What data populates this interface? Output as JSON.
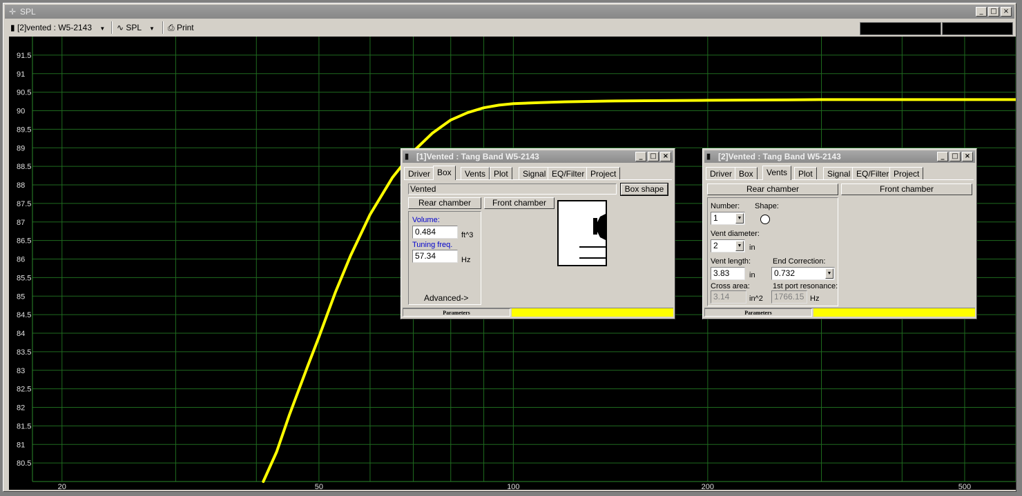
{
  "window": {
    "title": "SPL"
  },
  "toolbar": {
    "project_select": "[2]vented : W5-2143",
    "plot_select": "SPL",
    "print_label": "Print"
  },
  "chart_data": {
    "type": "line",
    "xscale": "log",
    "xlim": [
      18,
      600
    ],
    "ylim": [
      80,
      92
    ],
    "x_ticks": [
      20,
      50,
      100,
      200,
      500
    ],
    "y_ticks": [
      "91.5",
      "91",
      "90.5",
      "90",
      "89.5",
      "89",
      "88.5",
      "88",
      "87.5",
      "87",
      "86.5",
      "86",
      "85.5",
      "85",
      "84.5",
      "84",
      "83.5",
      "83",
      "82.5",
      "82",
      "81.5",
      "81",
      "80.5"
    ],
    "grid": true,
    "series": [
      {
        "color": "#ffff00",
        "x": [
          41,
          43,
          45,
          48,
          50,
          53,
          56,
          60,
          65,
          70,
          75,
          80,
          85,
          90,
          95,
          100,
          110,
          120,
          140,
          160,
          200,
          250,
          300,
          400,
          500,
          600
        ],
        "y": [
          80.0,
          80.8,
          81.8,
          83.1,
          83.9,
          85.1,
          86.1,
          87.2,
          88.2,
          88.9,
          89.4,
          89.75,
          89.95,
          90.08,
          90.15,
          90.19,
          90.22,
          90.24,
          90.26,
          90.27,
          90.28,
          90.29,
          90.3,
          90.3,
          90.3,
          90.3
        ]
      }
    ]
  },
  "box_window": {
    "title": "[1]Vented : Tang Band W5-2143",
    "tabs": [
      "Driver",
      "Box",
      "Vents",
      "Plot",
      "Signal",
      "EQ/Filter",
      "Project"
    ],
    "active_tab": "Box",
    "box_type": "Vented",
    "box_shape_button": "Box shape",
    "rear_chamber_button": "Rear chamber",
    "front_chamber_button": "Front chamber",
    "volume_label": "Volume:",
    "volume_value": "0.484",
    "volume_unit": "ft^3",
    "tuning_label": "Tuning freq.",
    "tuning_value": "57.34",
    "tuning_unit": "Hz",
    "advanced_label": "Advanced->",
    "status_label": "Parameters"
  },
  "vents_window": {
    "title": "[2]Vented : Tang Band W5-2143",
    "tabs": [
      "Driver",
      "Box",
      "Vents",
      "Plot",
      "Signal",
      "EQ/Filter",
      "Project"
    ],
    "active_tab": "Vents",
    "rear_chamber_button": "Rear chamber",
    "front_chamber_button": "Front chamber",
    "number_label": "Number:",
    "number_value": "1",
    "shape_label": "Shape:",
    "vent_diameter_label": "Vent diameter:",
    "vent_diameter_value": "2",
    "vent_diameter_unit": "in",
    "vent_length_label": "Vent length:",
    "vent_length_value": "3.83",
    "vent_length_unit": "in",
    "end_correction_label": "End Correction:",
    "end_correction_value": "0.732",
    "cross_area_label": "Cross area:",
    "cross_area_value": "3.14",
    "cross_area_unit": "in^2",
    "port_resonance_label": "1st port resonance:",
    "port_resonance_value": "1766.15",
    "port_resonance_unit": "Hz",
    "status_label": "Parameters"
  }
}
